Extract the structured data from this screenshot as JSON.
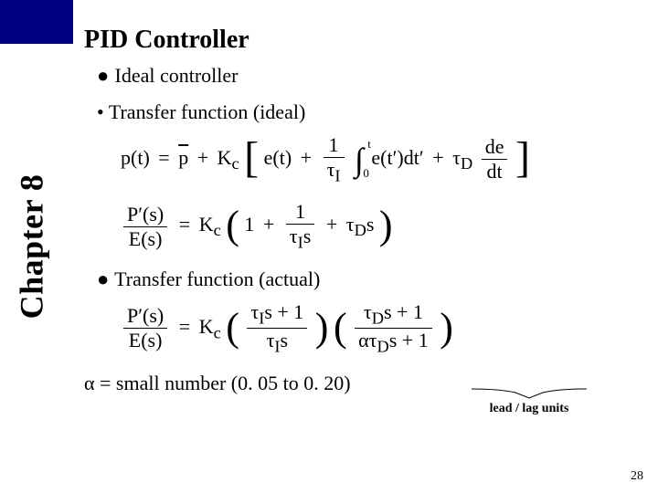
{
  "sidebar": {
    "chapter_label": "Chapter 8"
  },
  "main": {
    "title": "PID Controller",
    "bullet1": "Ideal controller",
    "bullet2": "Transfer function (ideal)",
    "bullet3": "Transfer function (actual)",
    "alpha_note": "α = small number (0. 05 to 0. 20)",
    "lead_lag": "lead / lag units"
  },
  "eq": {
    "p_t": "p(t)",
    "eq": "=",
    "pbar": "p",
    "plus": "+",
    "Kc": "K",
    "Kc_sub": "c",
    "e_t": "e(t)",
    "one": "1",
    "tauI": "τ",
    "I": "I",
    "int_up": "t",
    "int_lo": "0",
    "e_tp": "e(t′)dt′",
    "tauD": "τ",
    "D": "D",
    "de": "de",
    "dt": "dt",
    "Pprime": "P′(s)",
    "Es": "E(s)",
    "tauIs_1": "1",
    "tauIs": "s",
    "tauIs_plus1": "s + 1",
    "tauDs_plus1": "s + 1",
    "alpha_tauD": "ατ"
  },
  "page_number": "28"
}
